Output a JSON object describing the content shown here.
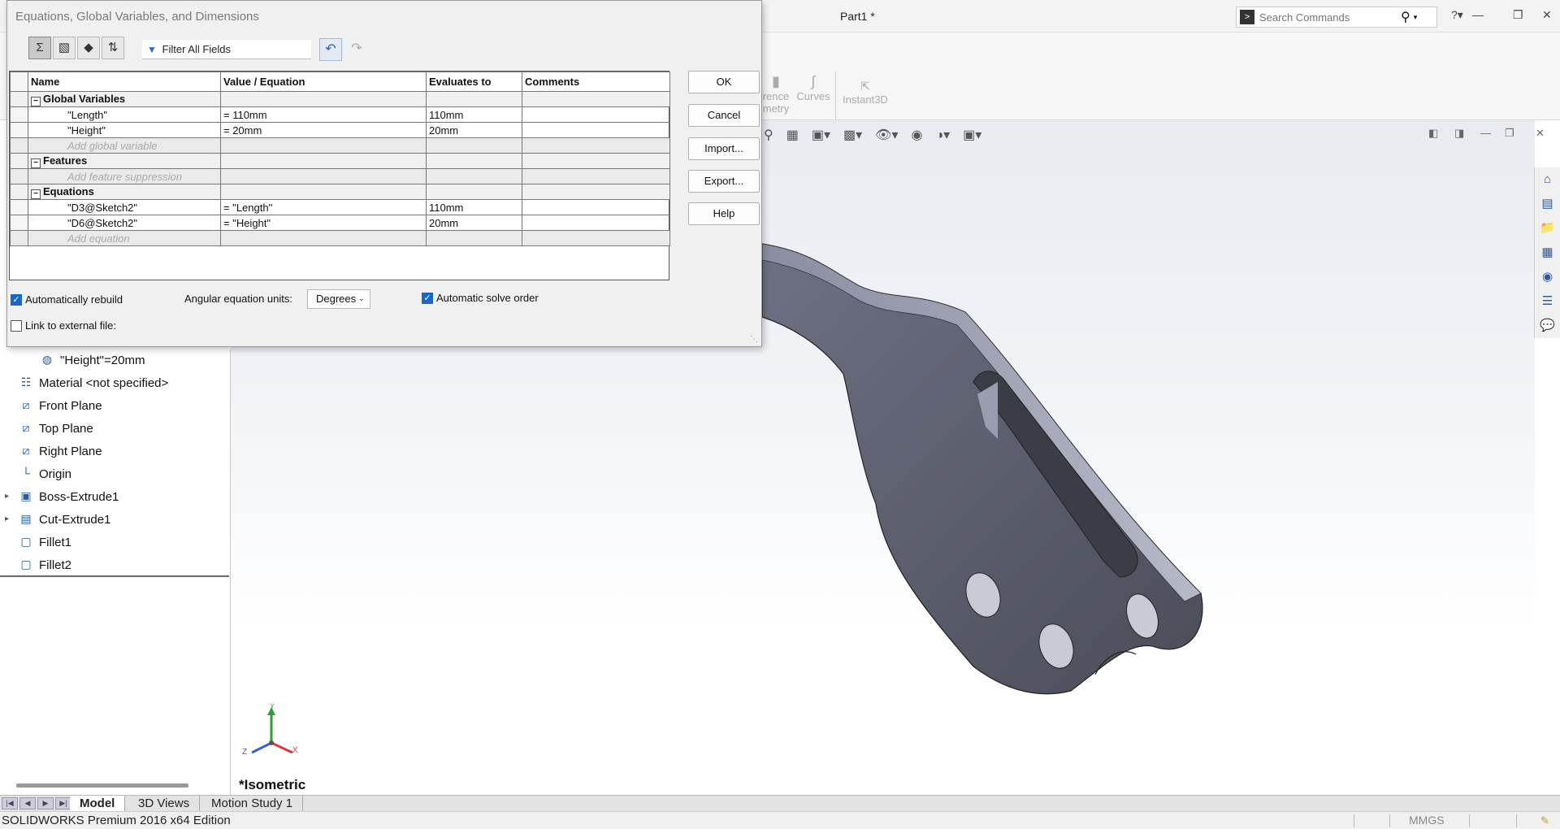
{
  "window": {
    "document_title": "Part1 *",
    "search_placeholder": "Search Commands"
  },
  "ribbon": {
    "reference_geometry_partial_1": "rence",
    "reference_geometry_partial_2": "metry",
    "curves": "Curves",
    "instant3d": "Instant3D"
  },
  "dialog": {
    "title": "Equations, Global Variables, and Dimensions",
    "filter_label": "Filter All Fields",
    "columns": [
      "Name",
      "Value / Equation",
      "Evaluates to",
      "Comments"
    ],
    "sections": {
      "global_variables": "Global Variables",
      "features": "Features",
      "equations": "Equations"
    },
    "global_variables": [
      {
        "name": "\"Length\"",
        "value": "= 110mm",
        "evaluates": "110mm",
        "comments": ""
      },
      {
        "name": "\"Height\"",
        "value": "= 20mm",
        "evaluates": "20mm",
        "comments": ""
      }
    ],
    "add_global_variable": "Add global variable",
    "add_feature_suppression": "Add feature suppression",
    "equations": [
      {
        "name": "\"D3@Sketch2\"",
        "value": "= \"Length\"",
        "evaluates": "110mm",
        "comments": ""
      },
      {
        "name": "\"D6@Sketch2\"",
        "value": "= \"Height\"",
        "evaluates": "20mm",
        "comments": ""
      }
    ],
    "add_equation": "Add equation",
    "buttons": {
      "ok": "OK",
      "cancel": "Cancel",
      "import": "Import...",
      "export": "Export...",
      "help": "Help"
    },
    "options": {
      "auto_rebuild": "Automatically rebuild",
      "auto_rebuild_checked": true,
      "angular_units_label": "Angular equation units:",
      "angular_units_value": "Degrees",
      "auto_solve": "Automatic solve order",
      "auto_solve_checked": true,
      "link_external": "Link to external file:",
      "link_external_checked": false
    }
  },
  "feature_tree": {
    "items": [
      {
        "label": "\"Height\"=20mm",
        "icon": "global-variable-icon"
      },
      {
        "label": "Material <not specified>",
        "icon": "material-icon"
      },
      {
        "label": "Front Plane",
        "icon": "plane-icon"
      },
      {
        "label": "Top Plane",
        "icon": "plane-icon"
      },
      {
        "label": "Right Plane",
        "icon": "plane-icon"
      },
      {
        "label": "Origin",
        "icon": "origin-icon"
      },
      {
        "label": "Boss-Extrude1",
        "icon": "extrude-icon"
      },
      {
        "label": "Cut-Extrude1",
        "icon": "cut-extrude-icon"
      },
      {
        "label": "Fillet1",
        "icon": "fillet-icon"
      },
      {
        "label": "Fillet2",
        "icon": "fillet-icon"
      }
    ]
  },
  "viewport": {
    "view_label": "*Isometric",
    "triad": {
      "y": "Y",
      "x": "X",
      "z": "Z"
    }
  },
  "tabs": [
    "Model",
    "3D Views",
    "Motion Study 1"
  ],
  "status": {
    "edition": "SOLIDWORKS Premium 2016 x64 Edition",
    "units": "MMGS"
  },
  "colors": {
    "accent": "#1b66c9",
    "model_gray": "#5c5f6e"
  }
}
